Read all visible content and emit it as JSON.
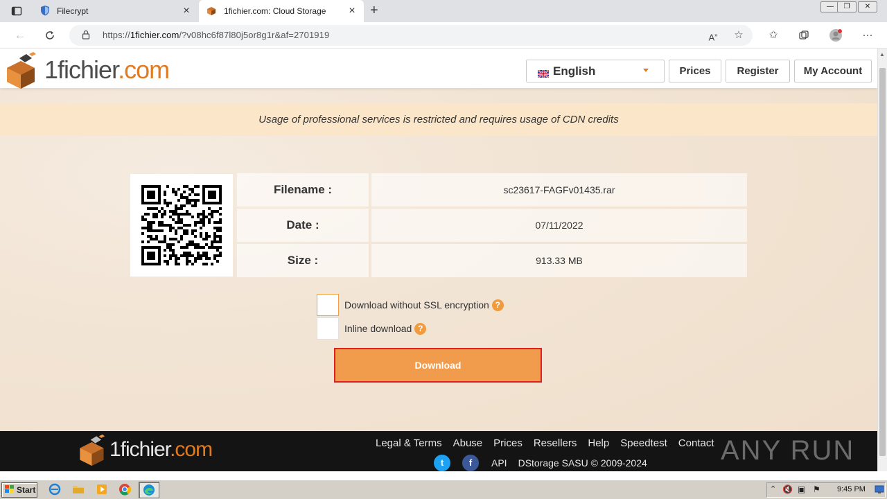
{
  "browser": {
    "tabs": [
      {
        "title": "Filecrypt",
        "active": false
      },
      {
        "title": "1fichier.com: Cloud Storage",
        "active": true
      }
    ],
    "url_prefix": "https://",
    "url_domain": "1fichier.com",
    "url_rest": "/?v08hc6f87l80j5or8g1r&af=2701919"
  },
  "site": {
    "logo_main": "1fichier",
    "logo_suffix": ".com",
    "language": "English",
    "nav": {
      "prices": "Prices",
      "register": "Register",
      "my_account": "My Account"
    },
    "notice": "Usage of professional services is restricted and requires usage of CDN credits"
  },
  "file": {
    "filename_label": "Filename :",
    "filename": "sc23617-FAGFv01435.rar",
    "date_label": "Date :",
    "date": "07/11/2022",
    "size_label": "Size :",
    "size": "913.33 MB"
  },
  "options": {
    "no_ssl": "Download without SSL encryption",
    "inline": "Inline download",
    "help": "?"
  },
  "download_label": "Download",
  "footer": {
    "links": [
      "Legal & Terms",
      "Abuse",
      "Prices",
      "Resellers",
      "Help",
      "Speedtest",
      "Contact"
    ],
    "api": "API",
    "copyright": "DStorage SASU © 2009-2024",
    "twitter": "t",
    "facebook": "f",
    "watermark": "ANY RUN"
  },
  "taskbar": {
    "start": "Start",
    "clock": "9:45 PM"
  },
  "colors": {
    "brand_orange": "#e07b1f",
    "download_fill": "#f19b4c",
    "download_border": "#e02020",
    "notice_bg": "#fbe6c9"
  }
}
